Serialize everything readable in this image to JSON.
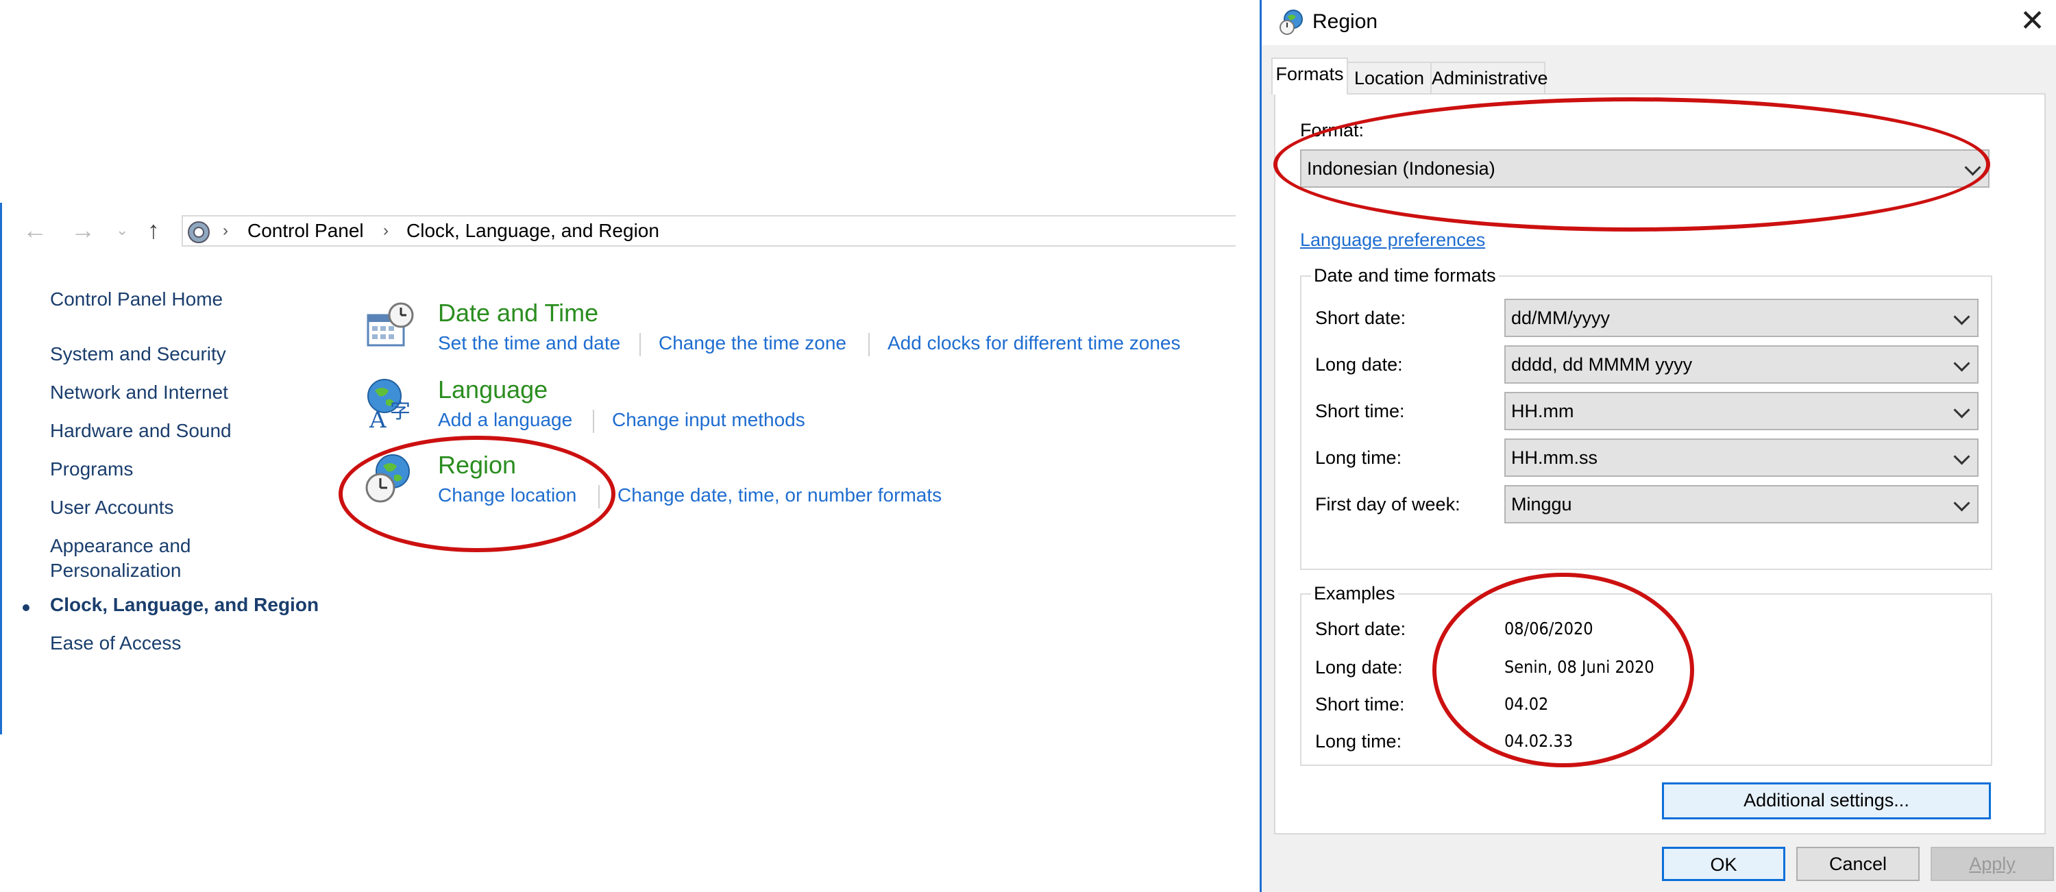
{
  "control_panel": {
    "breadcrumb": [
      "Control Panel",
      "Clock, Language, and Region"
    ],
    "sidebar": {
      "home": "Control Panel Home",
      "items": [
        "System and Security",
        "Network and Internet",
        "Hardware and Sound",
        "Programs",
        "User Accounts",
        "Appearance and",
        "Personalization",
        "Clock, Language, and Region",
        "Ease of Access"
      ]
    },
    "categories": {
      "datetime": {
        "title": "Date and Time",
        "links": [
          "Set the time and date",
          "Change the time zone",
          "Add clocks for different time zones"
        ]
      },
      "language": {
        "title": "Language",
        "links": [
          "Add a language",
          "Change input methods"
        ]
      },
      "region": {
        "title": "Region",
        "links": [
          "Change location",
          "Change date, time, or number formats"
        ]
      }
    }
  },
  "dialog": {
    "title": "Region",
    "tabs": [
      "Formats",
      "Location",
      "Administrative"
    ],
    "format_label": "Format:",
    "format_value": "Indonesian (Indonesia)",
    "language_link": "Language preferences",
    "dt_group": "Date and time formats",
    "rows": [
      {
        "label": "Short date:",
        "value": "dd/MM/yyyy"
      },
      {
        "label": "Long date:",
        "value": "dddd, dd MMMM yyyy"
      },
      {
        "label": "Short time:",
        "value": "HH.mm"
      },
      {
        "label": "Long time:",
        "value": "HH.mm.ss"
      },
      {
        "label": "First day of week:",
        "value": "Minggu"
      }
    ],
    "examples_group": "Examples",
    "examples": [
      {
        "label": "Short date:",
        "value": "08/06/2020"
      },
      {
        "label": "Long date:",
        "value": "Senin, 08 Juni 2020"
      },
      {
        "label": "Short time:",
        "value": "04.02"
      },
      {
        "label": "Long time:",
        "value": "04.02.33"
      }
    ],
    "additional_button": "Additional settings...",
    "ok": "OK",
    "cancel": "Cancel",
    "apply": "Apply"
  },
  "colors": {
    "accent": "#1e6fd0",
    "category_title": "#2a8d1f",
    "link": "#1e6dd0",
    "annotation": "#cc1010"
  }
}
